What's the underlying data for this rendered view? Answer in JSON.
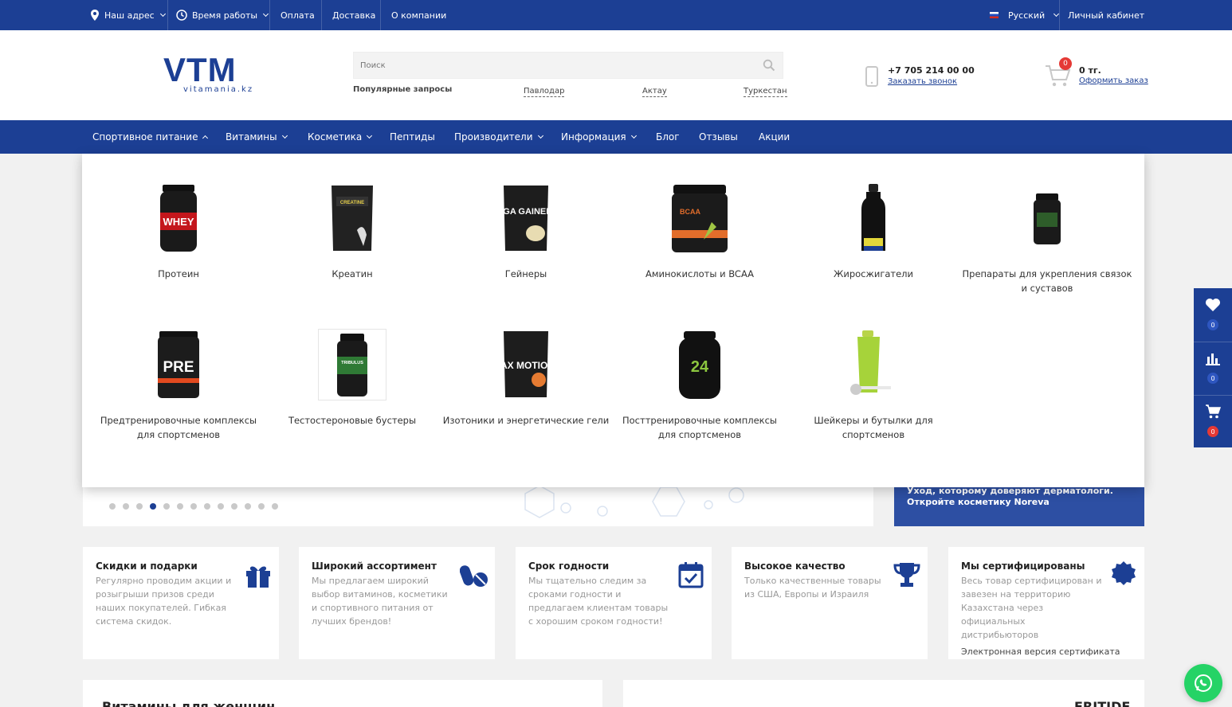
{
  "topbar": {
    "address": "Наш адрес",
    "hours": "Время работы",
    "payment": "Оплата",
    "delivery": "Доставка",
    "about": "О компании",
    "language": "Русский",
    "account": "Личный кабинет"
  },
  "header": {
    "logo_big": "VTM",
    "logo_small": "vitamania.kz",
    "search_placeholder": "Поиск",
    "popular_label": "Популярные запросы",
    "quick_links": [
      "Павлодар",
      "Актау",
      "Туркестан"
    ],
    "phone": "+7 705 214 00 00",
    "callback": "Заказать звонок",
    "cart_count": "0",
    "cart_sum": "0 тг.",
    "checkout": "Оформить заказ"
  },
  "nav": {
    "items": [
      "Спортивное питание",
      "Витамины",
      "Косметика",
      "Пептиды",
      "Производители",
      "Информация",
      "Блог",
      "Отзывы",
      "Акции"
    ]
  },
  "dropdown": {
    "categories": [
      "Протеин",
      "Креатин",
      "Гейнеры",
      "Аминокислоты и BCAA",
      "Жиросжигатели",
      "Препараты для укрепления связок и суставов",
      "Предтренировочные комплексы для спортсменов",
      "Тестостероновые бустеры",
      "Изотоники и энергетические гели",
      "Посттренировочные комплексы для спортсменов",
      "Шейкеры и бутылки для спортсменов"
    ],
    "product_labels": [
      "WHEY",
      "CREATINE",
      "MEGA GAINER",
      "BCAA",
      "",
      "",
      "PRE",
      "TRIBULUS",
      "MAX MOTION",
      "24",
      ""
    ]
  },
  "slider": {
    "dots_count": 13,
    "active_dot": 4,
    "promo_text_1": "Уход, которому доверяют дерматологи.",
    "promo_text_2": "Откройте косметику Noreva"
  },
  "features": [
    {
      "title": "Скидки и подарки",
      "text": "Регулярно проводим акции и розыгрыши призов среди наших покупателей. Гибкая система скидок.",
      "icon": "gift-icon"
    },
    {
      "title": "Широкий ассортимент",
      "text": "Мы предлагаем широкий выбор витаминов, косметики и спортивного питания от лучших брендов!",
      "icon": "pills-icon"
    },
    {
      "title": "Срок годности",
      "text": "Мы тщательно следим за сроками годности и предлагаем клиентам товары с хорошим сроком годности!",
      "icon": "calendar-check-icon"
    },
    {
      "title": "Высокое качество",
      "text": "Только качественные товары из США, Европы и Израиля",
      "icon": "trophy-icon"
    },
    {
      "title": "Мы сертифицированы",
      "text": "Весь товар сертифицирован и завезен на территорию Казахстана через официальных дистрибьюторов",
      "link": "Электронная версия сертификата",
      "icon": "certificate-icon"
    }
  ],
  "side_panel": {
    "favorites": "0",
    "compare": "0",
    "cart": "0"
  },
  "bottom": {
    "left_title": "Витамины для женщин",
    "right_title": "ERITIDE"
  },
  "colors": {
    "brand": "#1c3f94",
    "badge_red": "#e53935",
    "whatsapp": "#25d366"
  }
}
